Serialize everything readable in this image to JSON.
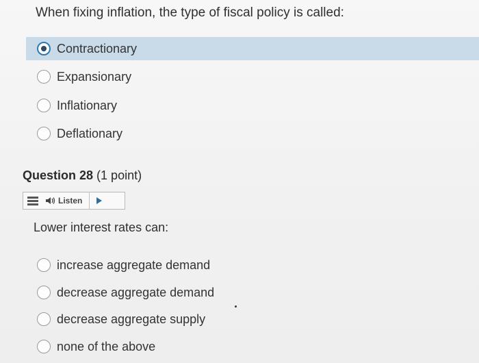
{
  "question27": {
    "text": "When fixing inflation, the type of fiscal policy is called:",
    "options": [
      {
        "label": "Contractionary",
        "selected": true
      },
      {
        "label": "Expansionary",
        "selected": false
      },
      {
        "label": "Inflationary",
        "selected": false
      },
      {
        "label": "Deflationary",
        "selected": false
      }
    ]
  },
  "question28": {
    "number_label": "Question 28",
    "points_label": "(1 point)",
    "listen_label": "Listen",
    "text": "Lower interest rates can:",
    "options": [
      {
        "label": "increase aggregate demand",
        "selected": false
      },
      {
        "label": "decrease aggregate demand",
        "selected": false
      },
      {
        "label": "decrease aggregate supply",
        "selected": false
      },
      {
        "label": "none of the above",
        "selected": false
      }
    ]
  },
  "colors": {
    "selected_row_bg": "#c9dbe9",
    "radio_checked_ring": "#2e7ab0",
    "play_icon": "#2e6e9e"
  },
  "icons": {
    "listen_menu": "menu-icon",
    "listen_speaker": "speaker-icon",
    "listen_play": "play-icon"
  }
}
